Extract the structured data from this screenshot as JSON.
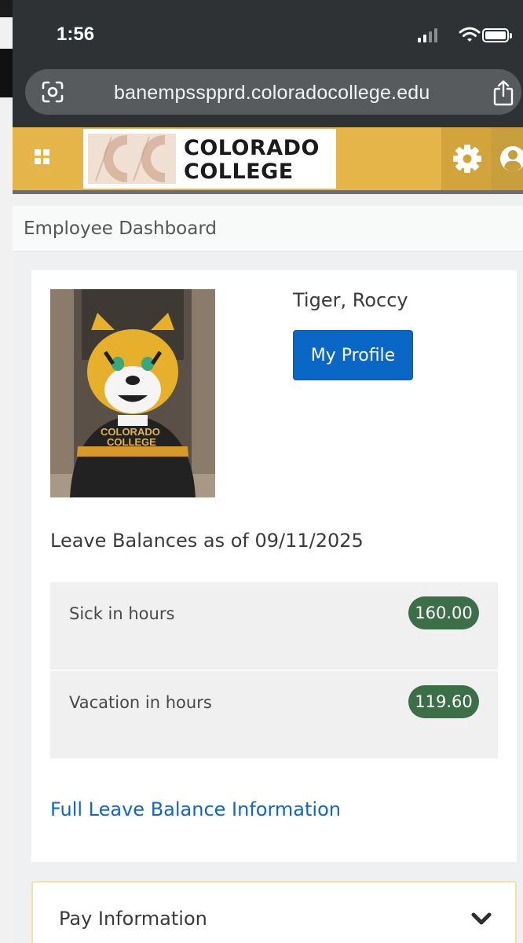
{
  "status_bar": {
    "time": "1:56"
  },
  "browser": {
    "url": "banempsspprd.coloradocollege.edu"
  },
  "header": {
    "logo_line1": "COLORADO",
    "logo_line2": "COLLEGE",
    "brand_color": "#e5b54a",
    "icons": [
      "grid-icon",
      "gear-icon",
      "user-icon"
    ]
  },
  "page": {
    "title": "Employee Dashboard"
  },
  "profile": {
    "name": "Tiger, Roccy",
    "my_profile_label": "My Profile",
    "photo_jersey_line1": "COLORADO",
    "photo_jersey_line2": "COLLEGE"
  },
  "leave": {
    "title": "Leave Balances as of 09/11/2025",
    "rows": [
      {
        "label": "Sick in hours",
        "value": "160.00"
      },
      {
        "label": "Vacation in hours",
        "value": "119.60"
      }
    ],
    "badge_color": "#3c6e47",
    "full_link": "Full Leave Balance Information"
  },
  "pay": {
    "title": "Pay Information"
  }
}
